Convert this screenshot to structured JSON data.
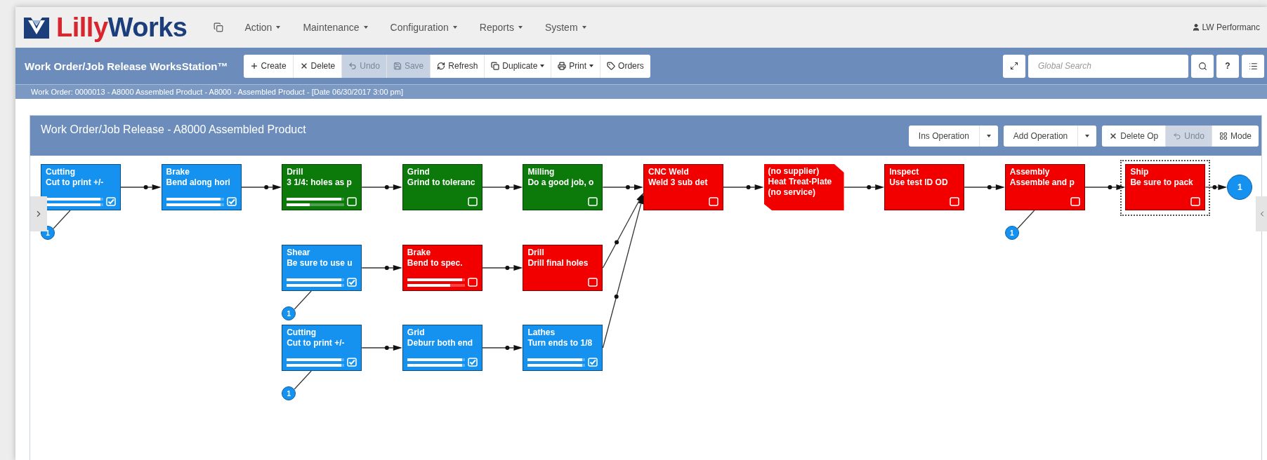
{
  "nav": {
    "brand_first": "Lilly",
    "brand_second": "Works",
    "menus": [
      {
        "label": "Action"
      },
      {
        "label": "Maintenance"
      },
      {
        "label": "Configuration"
      },
      {
        "label": "Reports"
      },
      {
        "label": "System"
      }
    ],
    "user": "LW Performanc"
  },
  "toolbar": {
    "title": "Work Order/Job Release WorksStation™",
    "buttons": [
      {
        "label": "Create",
        "disabled": false,
        "dropdown": false
      },
      {
        "label": "Delete",
        "disabled": false,
        "dropdown": false
      },
      {
        "label": "Undo",
        "disabled": true,
        "dropdown": false
      },
      {
        "label": "Save",
        "disabled": true,
        "dropdown": false
      },
      {
        "label": "Refresh",
        "disabled": false,
        "dropdown": false
      },
      {
        "label": "Duplicate",
        "disabled": false,
        "dropdown": true
      },
      {
        "label": "Print",
        "disabled": false,
        "dropdown": true
      },
      {
        "label": "Orders",
        "disabled": false,
        "dropdown": false
      }
    ],
    "search": {
      "placeholder": "Global Search"
    },
    "help": "?"
  },
  "work_order": "Work Order: 0000013 - A8000 Assembled Product - A8000 - Assembled Product - [Date 06/30/2017 3:00 pm]",
  "panel": {
    "title": "Work Order/Job Release - A8000 Assembled Product",
    "actions": [
      {
        "label": "Ins Operation",
        "kind": "split"
      },
      {
        "label": "Add Operation",
        "kind": "split"
      },
      {
        "label": "Delete Op",
        "kind": "delete"
      },
      {
        "label": "Undo",
        "kind": "undo"
      },
      {
        "label": "Mode",
        "kind": "mode"
      }
    ]
  },
  "lanes": [
    {
      "nodes": [
        {
          "kind": "task",
          "title": "Cutting",
          "description": "Cut to print +/-",
          "color": "#1592f0",
          "checked": true,
          "selected": false,
          "bars": [
            {
              "level": 0.95
            },
            {
              "level": 0.95
            }
          ],
          "badge": "1"
        },
        {
          "kind": "task",
          "title": "Brake",
          "description": "Bend along hori",
          "color": "#1592f0",
          "checked": true,
          "selected": false,
          "bars": [
            {
              "level": 0.95
            },
            {
              "level": 0.95
            }
          ]
        },
        {
          "kind": "task",
          "title": "Drill",
          "description": "3 1/4: holes as p",
          "color": "#0b7a0b",
          "checked": false,
          "selected": false,
          "bars": [
            {
              "level": 0.95
            },
            {
              "level": 0.4
            }
          ]
        },
        {
          "kind": "task",
          "title": "Grind",
          "description": "Grind to toleranc",
          "color": "#0b7a0b",
          "checked": false,
          "selected": false
        },
        {
          "kind": "task",
          "title": "Milling",
          "description": "Do a good job, o",
          "color": "#0b7a0b",
          "checked": false,
          "selected": false
        },
        {
          "kind": "task",
          "title": "CNC Weld",
          "description": "Weld 3 sub det",
          "color": "#f20000",
          "checked": false,
          "selected": false
        },
        {
          "kind": "outsourced",
          "title": "(no supplier)",
          "description": "Heat Treat-Plate",
          "note": "(no service)",
          "color": "#f20000",
          "selected": false
        },
        {
          "kind": "task",
          "title": "Inspect",
          "description": "Use test ID OD",
          "color": "#f20000",
          "checked": false,
          "selected": false
        },
        {
          "kind": "task",
          "title": "Assembly",
          "description": "Assemble and p",
          "color": "#f20000",
          "checked": false,
          "selected": false,
          "badge": "1"
        },
        {
          "kind": "task",
          "title": "Ship",
          "description": "Be sure to pack",
          "color": "#f20000",
          "checked": false,
          "selected": true
        }
      ],
      "end": "1"
    },
    {
      "nodes": [
        {
          "kind": "task",
          "title": "Shear",
          "description": "Be sure to use u",
          "color": "#1592f0",
          "checked": true,
          "selected": false,
          "bars": [
            {
              "level": 0.95
            },
            {
              "level": 0.95
            }
          ],
          "badge": "1"
        },
        {
          "kind": "task",
          "title": "Brake",
          "description": "Bend to spec.",
          "color": "#f20000",
          "checked": false,
          "selected": false,
          "bars": [
            {
              "level": 0.95
            },
            {
              "level": 0.75
            }
          ]
        },
        {
          "kind": "task",
          "title": "Drill",
          "description": "Drill final holes",
          "color": "#f20000",
          "checked": false,
          "selected": false
        }
      ]
    },
    {
      "nodes": [
        {
          "kind": "task",
          "title": "Cutting",
          "description": "Cut to print +/-",
          "color": "#1592f0",
          "checked": true,
          "selected": false,
          "bars": [
            {
              "level": 0.95
            },
            {
              "level": 0.95
            }
          ],
          "badge": "1"
        },
        {
          "kind": "task",
          "title": "Grid",
          "description": "Deburr both end",
          "color": "#1592f0",
          "checked": true,
          "selected": false,
          "bars": [
            {
              "level": 0.95
            },
            {
              "level": 0.95
            }
          ]
        },
        {
          "kind": "task",
          "title": "Lathes",
          "description": "Turn ends to 1/8",
          "color": "#1592f0",
          "checked": true,
          "selected": false,
          "bars": [
            {
              "level": 0.95
            },
            {
              "level": 0.95
            }
          ]
        }
      ]
    }
  ]
}
